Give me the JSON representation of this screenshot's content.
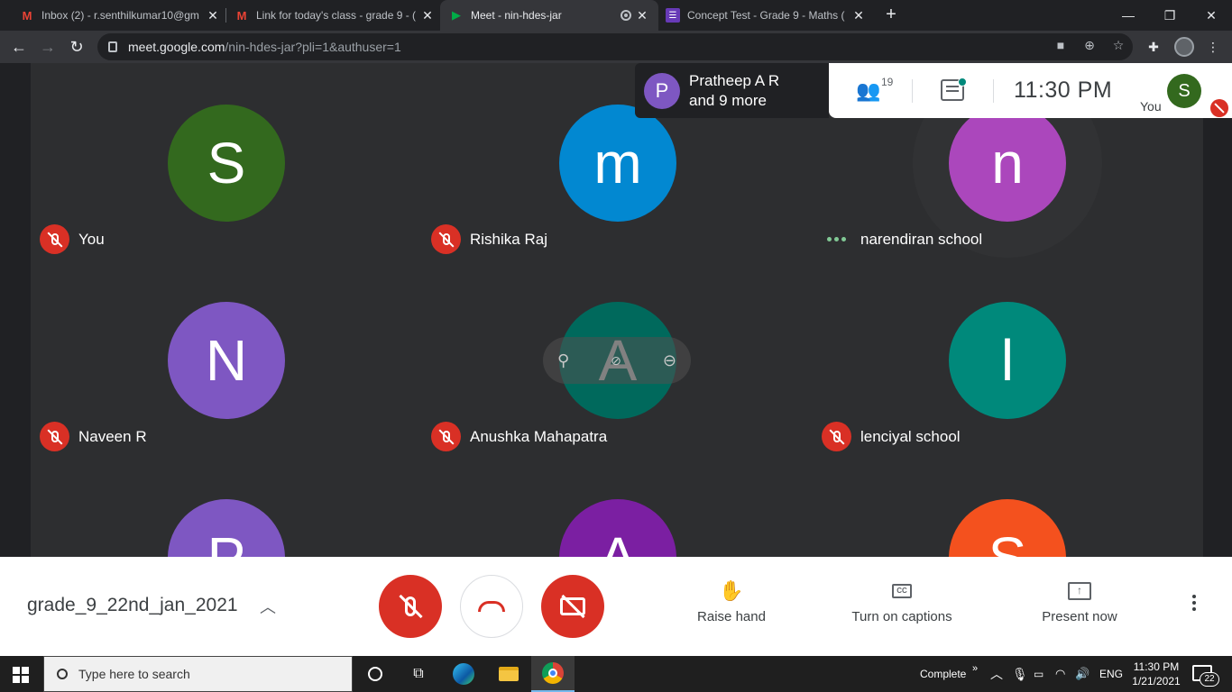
{
  "browser": {
    "tabs": [
      {
        "title": "Inbox (2) - r.senthilkumar10@gm",
        "favicon": "gmail-icon",
        "color": "#ea4335"
      },
      {
        "title": "Link for today's class - grade 9 - (",
        "favicon": "gmail-icon",
        "color": "#ea4335"
      },
      {
        "title": "Meet - nin-hdes-jar",
        "favicon": "meet-icon",
        "color": "#00ac47"
      },
      {
        "title": "Concept Test - Grade 9 - Maths (",
        "favicon": "forms-icon",
        "color": "#673ab7"
      }
    ],
    "url_host": "meet.google.com",
    "url_path": "/nin-hdes-jar?pli=1&authuser=1"
  },
  "meet": {
    "presenter_name": "Pratheep A R",
    "presenter_more": "and 9 more",
    "presenter_initial": "P",
    "participant_count": "19",
    "time": "11:30  PM",
    "self_label": "You",
    "self_initial": "S",
    "participants": [
      {
        "name": "You",
        "initial": "S",
        "color": "#33691e",
        "muted": true
      },
      {
        "name": "Rishika Raj",
        "initial": "m",
        "color": "#0288d1",
        "muted": true
      },
      {
        "name": "narendiran school",
        "initial": "n",
        "color": "#ab47bc",
        "muted": false
      },
      {
        "name": "Naveen R",
        "initial": "N",
        "color": "#7e57c2",
        "muted": true
      },
      {
        "name": "Anushka Mahapatra",
        "initial": "A",
        "color": "#00695c",
        "muted": true
      },
      {
        "name": "lenciyal school",
        "initial": "l",
        "color": "#00897b",
        "muted": true
      },
      {
        "name": "",
        "initial": "P",
        "color": "#7e57c2",
        "muted": false
      },
      {
        "name": "",
        "initial": "A",
        "color": "#7b1fa2",
        "muted": false
      },
      {
        "name": "",
        "initial": "S",
        "color": "#f4511e",
        "muted": false
      }
    ],
    "meeting_name": "grade_9_22nd_jan_2021",
    "actions": {
      "raise_hand": "Raise hand",
      "captions": "Turn on captions",
      "present": "Present now"
    }
  },
  "taskbar": {
    "search_placeholder": "Type here to search",
    "tray_label": "Complete",
    "language": "ENG",
    "clock_time": "11:30 PM",
    "clock_date": "1/21/2021",
    "notification_count": "22"
  }
}
